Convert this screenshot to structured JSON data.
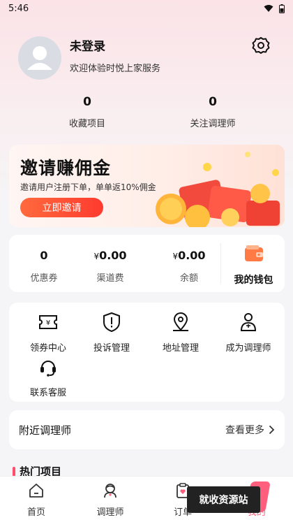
{
  "status_bar": {
    "time": "5:46"
  },
  "profile": {
    "name": "未登录",
    "subtitle": "欢迎体验时悦上家服务"
  },
  "stats": [
    {
      "value": "0",
      "label": "收藏项目"
    },
    {
      "value": "0",
      "label": "关注调理师"
    }
  ],
  "invite": {
    "title": "邀请赚佣金",
    "description": "邀请用户注册下单，单单返10%佣金",
    "button_label": "立即邀请"
  },
  "wallet": {
    "items": [
      {
        "value": "0",
        "label": "优惠券"
      },
      {
        "currency": "¥",
        "value": "0.00",
        "label": "渠道费"
      },
      {
        "currency": "¥",
        "value": "0.00",
        "label": "余额"
      }
    ],
    "my_wallet_label": "我的钱包"
  },
  "services": [
    {
      "label": "领券中心",
      "icon": "coupon-icon"
    },
    {
      "label": "投诉管理",
      "icon": "shield-icon"
    },
    {
      "label": "地址管理",
      "icon": "location-icon"
    },
    {
      "label": "成为调理师",
      "icon": "therapist-icon"
    },
    {
      "label": "联系客服",
      "icon": "headset-icon"
    }
  ],
  "nearby": {
    "title": "附近调理师",
    "more_label": "查看更多"
  },
  "hot": {
    "title": "热门项目"
  },
  "tabbar": [
    {
      "label": "首页",
      "icon": "home-icon"
    },
    {
      "label": "调理师",
      "icon": "therapist-icon"
    },
    {
      "label": "订单",
      "icon": "order-icon"
    },
    {
      "label": "我的",
      "icon": "mine-icon"
    }
  ],
  "watermark": {
    "text": "就收资源站"
  },
  "colors": {
    "accent": "#ff4b2f",
    "pink": "#ff5f7c",
    "wallet_orange": "#ff6a3d"
  }
}
